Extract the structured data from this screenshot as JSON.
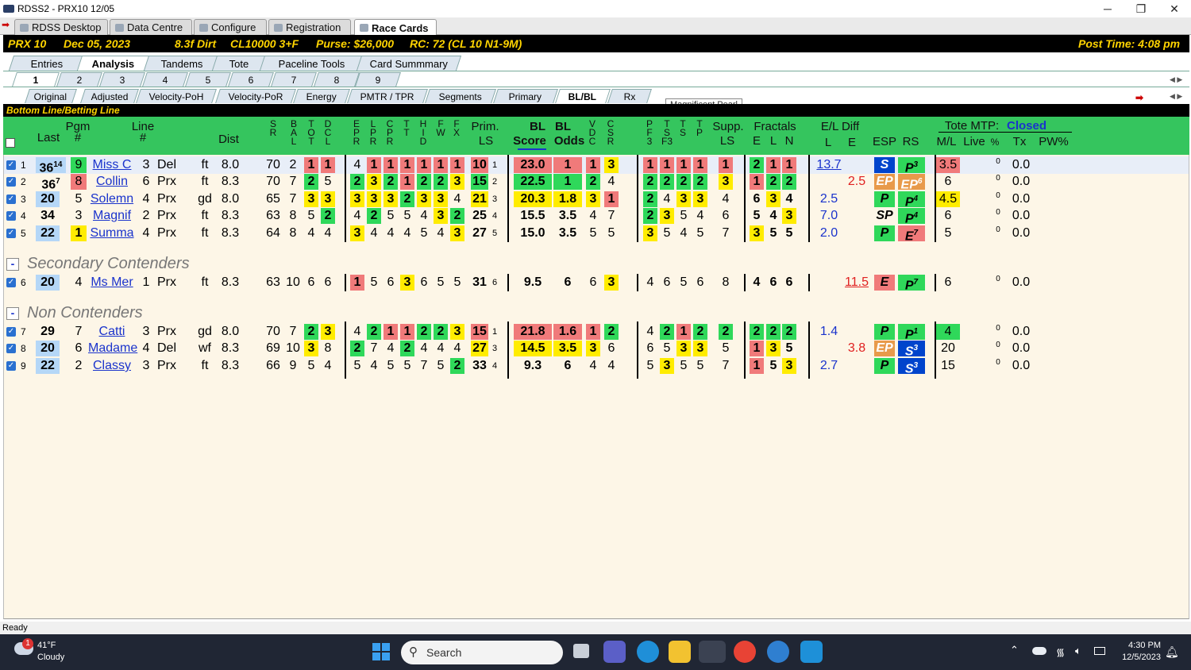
{
  "window": {
    "title": "RDSS2 - PRX10  12/05",
    "minimize": "─",
    "maximize": "❐",
    "close": "✕"
  },
  "main_tabs": [
    "RDSS Desktop",
    "Data Centre",
    "Configure",
    "Registration",
    "Race Cards"
  ],
  "race_info": {
    "track_race": "PRX 10",
    "date": "Dec 05, 2023",
    "surface": "8.3f  Dirt",
    "class": "CL10000  3+F",
    "purse": "Purse: $26,000",
    "rc": "RC: 72  (CL 10 N1-9M)",
    "post_time": "Post Time: 4:08 pm"
  },
  "view_tabs": [
    "Entries",
    "Analysis",
    "Tandems",
    "Tote",
    "Paceline Tools",
    "Card Summmary"
  ],
  "race_tabs": [
    "1",
    "2",
    "3",
    "4",
    "5",
    "6",
    "7",
    "8",
    "9"
  ],
  "report_tabs": [
    "Original",
    "Adjusted",
    "Velocity-PoH",
    "Velocity-PoR",
    "Energy",
    "PMTR / TPR",
    "Segments",
    "Primary",
    "BL/BL",
    "Rx"
  ],
  "tooltip": "Magnificent Pearl",
  "section_bar": "Bottom Line/Betting Line",
  "headers": {
    "last": "Last",
    "pgm": "Pgm",
    "pgm_hash": "#",
    "line": "Line",
    "line_hash": "#",
    "dist": "Dist",
    "sr": "S\nR",
    "bal": "B\nA\nL",
    "tot": "T\nO\nT",
    "dcl": "D\nC\nL",
    "epr": "E\nP\nR",
    "lpr": "L\nP\nR",
    "cpr": "C\nP\nR",
    "tt": "T\nT",
    "hid": "H\nI\nD",
    "fw": "F\nW",
    "fx": "F\nX",
    "prim": "Prim.",
    "prim_ls": "LS",
    "bl": "BL",
    "bl2": "BL",
    "score": "Score",
    "odds": "Odds",
    "vdc": "V\nD\nC",
    "csr": "C\nS\nR",
    "pf3": "P\nF\n3",
    "tsf3": "T\nS\nF3",
    "ts": "T\nS",
    "tp": "T\nP",
    "supp": "Supp.",
    "supp_ls": "LS",
    "fractals": "Fractals",
    "frac_e": "E",
    "frac_l": "L",
    "frac_n": "N",
    "el_diff": "E/L Diff",
    "el_l": "L",
    "el_e": "E",
    "esp": "ESP",
    "rs": "RS",
    "tote_mtp": "Tote MTP:",
    "tote_status": "Closed",
    "ml": "M/L",
    "live": "Live",
    "pct": "%",
    "tx": "Tx",
    "pw": "PW%"
  },
  "sections": {
    "secondary": "Secondary Contenders",
    "non": "Non Contenders",
    "collapse": "-"
  },
  "rows": [
    {
      "n": "1",
      "last": "36",
      "lastsup": "14",
      "pgm": "9",
      "name": "Miss C",
      "line": "3",
      "trk": "Del",
      "cond": "ft",
      "dist": "8.0",
      "sr": "70",
      "bal": "2",
      "tot": "1",
      "dcl": "1",
      "epr": "4",
      "lpr": "1",
      "cpr": "1",
      "tt": "1",
      "hid": "1",
      "fw": "1",
      "fx": "1",
      "prim": "10",
      "primsub": "1",
      "score": "23.0",
      "odds": "1",
      "vdc": "1",
      "csr": "3",
      "pf3": "1",
      "tsf3": "1",
      "ts": "1",
      "tp": "1",
      "supp": "1",
      "fe": "2",
      "fl": "1",
      "fn": "1",
      "ell": "13.7",
      "ele": "",
      "esp": "S",
      "rs": "P",
      "rssup": "3",
      "ml": "3.5",
      "live": "0",
      "tx": "0.0"
    },
    {
      "n": "2",
      "last": "36",
      "lastsup": "7",
      "pgm": "8",
      "name": "Collin",
      "line": "6",
      "trk": "Prx",
      "cond": "ft",
      "dist": "8.3",
      "sr": "70",
      "bal": "7",
      "tot": "2",
      "dcl": "5",
      "epr": "2",
      "lpr": "3",
      "cpr": "2",
      "tt": "1",
      "hid": "2",
      "fw": "2",
      "fx": "3",
      "prim": "15",
      "primsub": "2",
      "score": "22.5",
      "odds": "1",
      "vdc": "2",
      "csr": "4",
      "pf3": "2",
      "tsf3": "2",
      "ts": "2",
      "tp": "2",
      "supp": "3",
      "fe": "1",
      "fl": "2",
      "fn": "2",
      "ell": "",
      "ele": "2.5",
      "esp": "EP",
      "rs": "EP",
      "rssup": "6",
      "ml": "6",
      "live": "0",
      "tx": "0.0"
    },
    {
      "n": "3",
      "last": "20",
      "lastsup": "",
      "pgm": "5",
      "name": "Solemn",
      "line": "4",
      "trk": "Prx",
      "cond": "gd",
      "dist": "8.0",
      "sr": "65",
      "bal": "7",
      "tot": "3",
      "dcl": "3",
      "epr": "3",
      "lpr": "3",
      "cpr": "3",
      "tt": "2",
      "hid": "3",
      "fw": "3",
      "fx": "4",
      "prim": "21",
      "primsub": "3",
      "score": "20.3",
      "odds": "1.8",
      "vdc": "3",
      "csr": "1",
      "pf3": "2",
      "tsf3": "4",
      "ts": "3",
      "tp": "3",
      "supp": "4",
      "fe": "6",
      "fl": "3",
      "fn": "4",
      "ell": "2.5",
      "ele": "",
      "esp": "P",
      "rs": "P",
      "rssup": "4",
      "ml": "4.5",
      "live": "0",
      "tx": "0.0"
    },
    {
      "n": "4",
      "last": "34",
      "lastsup": "",
      "pgm": "3",
      "name": "Magnif",
      "line": "2",
      "trk": "Prx",
      "cond": "ft",
      "dist": "8.3",
      "sr": "63",
      "bal": "8",
      "tot": "5",
      "dcl": "2",
      "epr": "4",
      "lpr": "2",
      "cpr": "5",
      "tt": "5",
      "hid": "4",
      "fw": "3",
      "fx": "2",
      "prim": "25",
      "primsub": "4",
      "score": "15.5",
      "odds": "3.5",
      "vdc": "4",
      "csr": "7",
      "pf3": "2",
      "tsf3": "3",
      "ts": "5",
      "tp": "4",
      "supp": "6",
      "fe": "5",
      "fl": "4",
      "fn": "3",
      "ell": "7.0",
      "ele": "",
      "esp": "SP",
      "rs": "P",
      "rssup": "4",
      "ml": "6",
      "live": "0",
      "tx": "0.0"
    },
    {
      "n": "5",
      "last": "22",
      "lastsup": "",
      "pgm": "1",
      "name": "Summa",
      "line": "4",
      "trk": "Prx",
      "cond": "ft",
      "dist": "8.3",
      "sr": "64",
      "bal": "8",
      "tot": "4",
      "dcl": "4",
      "epr": "3",
      "lpr": "4",
      "cpr": "4",
      "tt": "4",
      "hid": "5",
      "fw": "4",
      "fx": "3",
      "prim": "27",
      "primsub": "5",
      "score": "15.0",
      "odds": "3.5",
      "vdc": "5",
      "csr": "5",
      "pf3": "3",
      "tsf3": "5",
      "ts": "4",
      "tp": "5",
      "supp": "7",
      "fe": "3",
      "fl": "5",
      "fn": "5",
      "ell": "2.0",
      "ele": "",
      "esp": "P",
      "rs": "E",
      "rssup": "7",
      "ml": "5",
      "live": "0",
      "tx": "0.0"
    },
    {
      "n": "6",
      "last": "20",
      "lastsup": "",
      "pgm": "4",
      "name": "Ms Mer",
      "line": "1",
      "trk": "Prx",
      "cond": "ft",
      "dist": "8.3",
      "sr": "63",
      "bal": "10",
      "tot": "6",
      "dcl": "6",
      "epr": "1",
      "lpr": "5",
      "cpr": "6",
      "tt": "3",
      "hid": "6",
      "fw": "5",
      "fx": "5",
      "prim": "31",
      "primsub": "6",
      "score": "9.5",
      "odds": "6",
      "vdc": "6",
      "csr": "3",
      "pf3": "4",
      "tsf3": "6",
      "ts": "5",
      "tp": "6",
      "supp": "8",
      "fe": "4",
      "fl": "6",
      "fn": "6",
      "ell": "",
      "ele": "11.5",
      "esp": "E",
      "rs": "P",
      "rssup": "7",
      "ml": "6",
      "live": "0",
      "tx": "0.0"
    },
    {
      "n": "7",
      "last": "29",
      "lastsup": "",
      "pgm": "7",
      "name": "Catti",
      "line": "3",
      "trk": "Prx",
      "cond": "gd",
      "dist": "8.0",
      "sr": "70",
      "bal": "7",
      "tot": "2",
      "dcl": "3",
      "epr": "4",
      "lpr": "2",
      "cpr": "1",
      "tt": "1",
      "hid": "2",
      "fw": "2",
      "fx": "3",
      "prim": "15",
      "primsub": "1",
      "score": "21.8",
      "odds": "1.6",
      "vdc": "1",
      "csr": "2",
      "pf3": "4",
      "tsf3": "2",
      "ts": "1",
      "tp": "2",
      "supp": "2",
      "fe": "2",
      "fl": "2",
      "fn": "2",
      "ell": "1.4",
      "ele": "",
      "esp": "P",
      "rs": "P",
      "rssup": "1",
      "ml": "4",
      "live": "0",
      "tx": "0.0"
    },
    {
      "n": "8",
      "last": "20",
      "lastsup": "",
      "pgm": "6",
      "name": "Madame",
      "line": "4",
      "trk": "Del",
      "cond": "wf",
      "dist": "8.3",
      "sr": "69",
      "bal": "10",
      "tot": "3",
      "dcl": "8",
      "epr": "2",
      "lpr": "7",
      "cpr": "4",
      "tt": "2",
      "hid": "4",
      "fw": "4",
      "fx": "4",
      "prim": "27",
      "primsub": "3",
      "score": "14.5",
      "odds": "3.5",
      "vdc": "3",
      "csr": "6",
      "pf3": "6",
      "tsf3": "5",
      "ts": "3",
      "tp": "3",
      "supp": "5",
      "fe": "1",
      "fl": "3",
      "fn": "5",
      "ell": "",
      "ele": "3.8",
      "esp": "EP",
      "rs": "S",
      "rssup": "3",
      "ml": "20",
      "live": "0",
      "tx": "0.0"
    },
    {
      "n": "9",
      "last": "22",
      "lastsup": "",
      "pgm": "2",
      "name": "Classy",
      "line": "3",
      "trk": "Prx",
      "cond": "ft",
      "dist": "8.3",
      "sr": "66",
      "bal": "9",
      "tot": "5",
      "dcl": "4",
      "epr": "5",
      "lpr": "4",
      "cpr": "5",
      "tt": "5",
      "hid": "7",
      "fw": "5",
      "fx": "2",
      "prim": "33",
      "primsub": "4",
      "score": "9.3",
      "odds": "6",
      "vdc": "4",
      "csr": "4",
      "pf3": "5",
      "tsf3": "3",
      "ts": "5",
      "tp": "5",
      "supp": "7",
      "fe": "1",
      "fl": "5",
      "fn": "3",
      "ell": "2.7",
      "ele": "",
      "esp": "P",
      "rs": "S",
      "rssup": "3",
      "ml": "15",
      "live": "0",
      "tx": "0.0"
    }
  ],
  "status": "Ready",
  "taskbar": {
    "weather_temp": "41°F",
    "weather_desc": "Cloudy",
    "weather_badge": "1",
    "search": "Search",
    "time": "4:30 PM",
    "date": "12/5/2023"
  },
  "colors": {
    "yellow": "#ffec00",
    "green": "#2fd85a",
    "red": "#f07a7a",
    "blue": "#0044cc",
    "orange": "#e89a4a",
    "header_green": "#35c55e"
  }
}
